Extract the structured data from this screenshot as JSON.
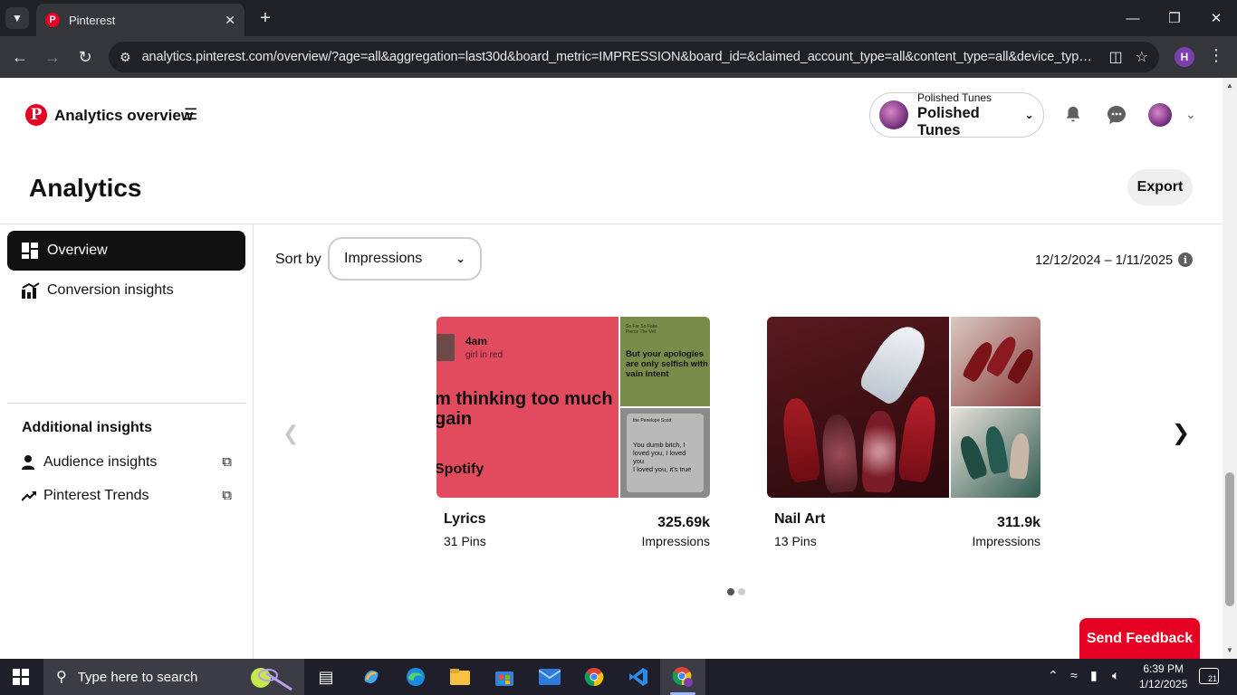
{
  "browser": {
    "tab_title": "Pinterest",
    "url": "analytics.pinterest.com/overview/?age=all&aggregation=last30d&board_metric=IMPRESSION&board_id=&claimed_account_type=all&content_type=all&device_type=...",
    "profile_initial": "H"
  },
  "header": {
    "title": "Analytics overview",
    "account_label": "Polished Tunes",
    "account_name": "Polished Tunes"
  },
  "page": {
    "title": "Analytics",
    "export_label": "Export"
  },
  "sidebar": {
    "items": [
      {
        "label": "Overview",
        "active": true
      },
      {
        "label": "Conversion insights",
        "active": false
      }
    ],
    "additional_heading": "Additional insights",
    "links": [
      {
        "label": "Audience insights"
      },
      {
        "label": "Pinterest Trends"
      }
    ]
  },
  "main": {
    "sort_label": "Sort by",
    "sort_value": "Impressions",
    "date_range": "12/12/2024 – 1/11/2025",
    "boards": [
      {
        "name": "Lyrics",
        "pins": "31 Pins",
        "value": "325.69k",
        "metric": "Impressions"
      },
      {
        "name": "Nail Art",
        "pins": "13 Pins",
        "value": "311.9k",
        "metric": "Impressions"
      }
    ],
    "lyrics_card": {
      "time": "4am",
      "artist": "girl in red",
      "lyric": "m thinking too much\ngain",
      "brand": "Spotify",
      "tr_small": "So Far So Fake\nPierce The Veil",
      "tr_text": "But your apologies\nare only selfish with\nvain intent",
      "br_small": "the\nPenelope Scott",
      "br_text": "You dumb bitch, I\nloved you, I loved\nyou\nI loved you, it's true"
    },
    "feedback_label": "Send Feedback"
  },
  "taskbar": {
    "search_placeholder": "Type here to search",
    "time": "6:39 PM",
    "date": "1/12/2025",
    "notification_count": "21"
  },
  "colors": {
    "brand": "#e60023",
    "active_nav": "#111111",
    "chrome_dark": "#202124"
  }
}
